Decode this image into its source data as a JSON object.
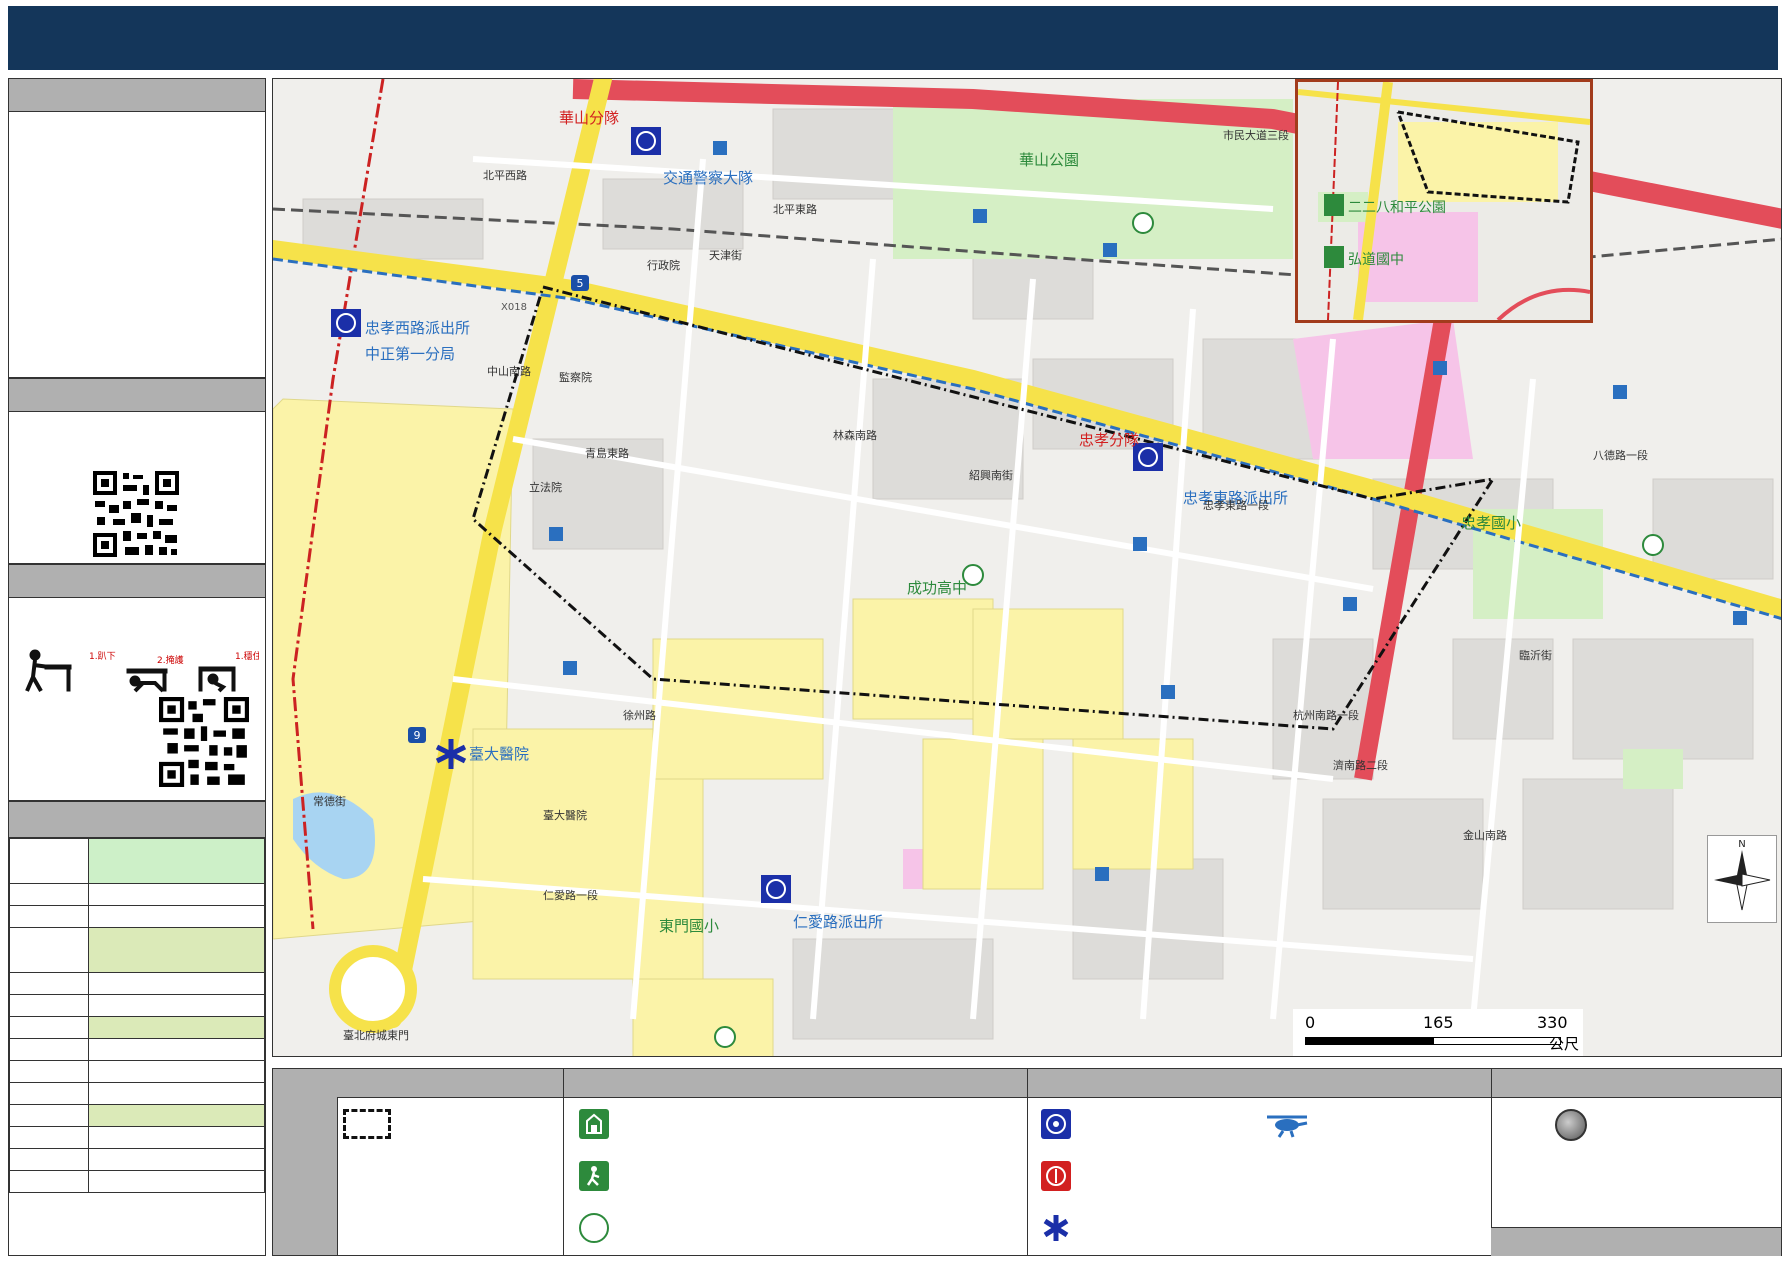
{
  "colors": {
    "title_bar": "#14365a",
    "panel_header": "#b0b0b0",
    "map_background": "#f0efec",
    "major_road": "#f6e24a",
    "expressway": "#e34d5a",
    "route_outline": "#111111",
    "school_area": "#fbf3a8",
    "park": "#d5efc5",
    "police_blue": "#1b2fa8",
    "fire_red": "#d22020",
    "info_blue": "#2a6fbf",
    "shelter_green": "#2d8a3c"
  },
  "map": {
    "labels_blue": [
      "交通警察大隊",
      "忠孝西路派出所",
      "中正第一分局",
      "忠孝東路派出所",
      "仁愛路派出所",
      "臺大醫院"
    ],
    "labels_red": [
      "華山分隊",
      "忠孝分隊"
    ],
    "labels_green": [
      "華山公園",
      "成功高中",
      "忠孝國小",
      "東門國小"
    ],
    "labels_dark": [
      "北平西路",
      "北平東路",
      "青島東路",
      "徐州路",
      "仁愛路一段",
      "中山南路",
      "杭州南路一段",
      "林森南路",
      "紹興南街",
      "監察院",
      "立法院",
      "行政院",
      "臺大醫院",
      "臺北府城東門",
      "市民大道三段",
      "八德路一段",
      "忠孝東路一段",
      "常德街",
      "天津街",
      "濟南路二段",
      "臨沂街",
      "金山南路"
    ],
    "road_shields": [
      "5",
      "9"
    ],
    "route_marker": "X018"
  },
  "inset_map": {
    "labels": [
      "二二八和平公園",
      "弘道國中"
    ]
  },
  "scale_bar": {
    "ticks": [
      "0",
      "165",
      "330"
    ],
    "unit": "公尺"
  },
  "north_arrow": {
    "label": "N"
  },
  "legend_icons": {
    "boundary": "dashed-boundary-icon",
    "shelter": "shelter-icon",
    "evacuation": "evacuation-site-icon",
    "reserve": "reserve-circle-icon",
    "police": "police-badge-icon",
    "fire": "fire-badge-icon",
    "medical": "medical-star-icon",
    "helicopter": "helicopter-icon",
    "assembly": "assembly-point-icon"
  },
  "instructions": {
    "step1": "1.趴下",
    "step2": "2.掩護",
    "step3": "1.穩住"
  }
}
